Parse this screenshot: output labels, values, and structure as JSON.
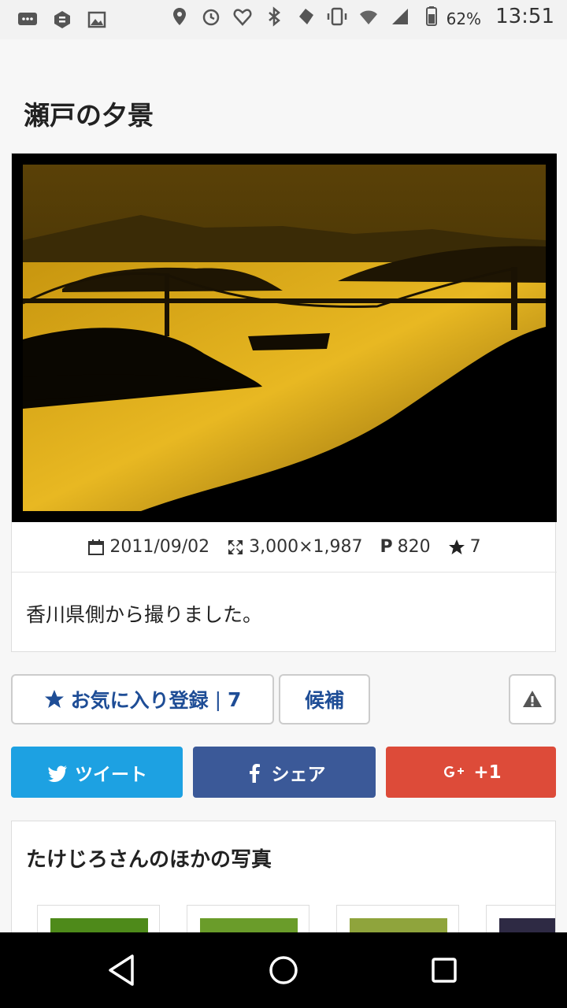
{
  "status_bar": {
    "battery_percent": "62%",
    "time": "13:51",
    "icons": [
      "message-icon",
      "app-icon",
      "image-icon",
      "location-icon",
      "alarm-icon",
      "heart-icon",
      "bluetooth-icon",
      "power-icon",
      "vibrate-icon",
      "wifi-icon",
      "signal-icon",
      "battery-icon"
    ]
  },
  "photo": {
    "title": "瀬戸の夕景",
    "date": "2011/09/02",
    "dimensions": "3,000×1,987",
    "points_label": "P",
    "points": "820",
    "stars": "7",
    "description": "香川県側から撮りました。"
  },
  "actions": {
    "favorite_label": "お気に入り登録",
    "favorite_separator": "|",
    "favorite_count": "7",
    "candidate_label": "候補"
  },
  "share": {
    "tweet_label": "ツイート",
    "facebook_label": "シェア",
    "google_label": "+1"
  },
  "others": {
    "title": "たけじろさんのほかの写真"
  },
  "colors": {
    "twitter": "#1da1e2",
    "facebook": "#3b5998",
    "google": "#dd4b39",
    "accent_blue": "#1e4d96"
  }
}
